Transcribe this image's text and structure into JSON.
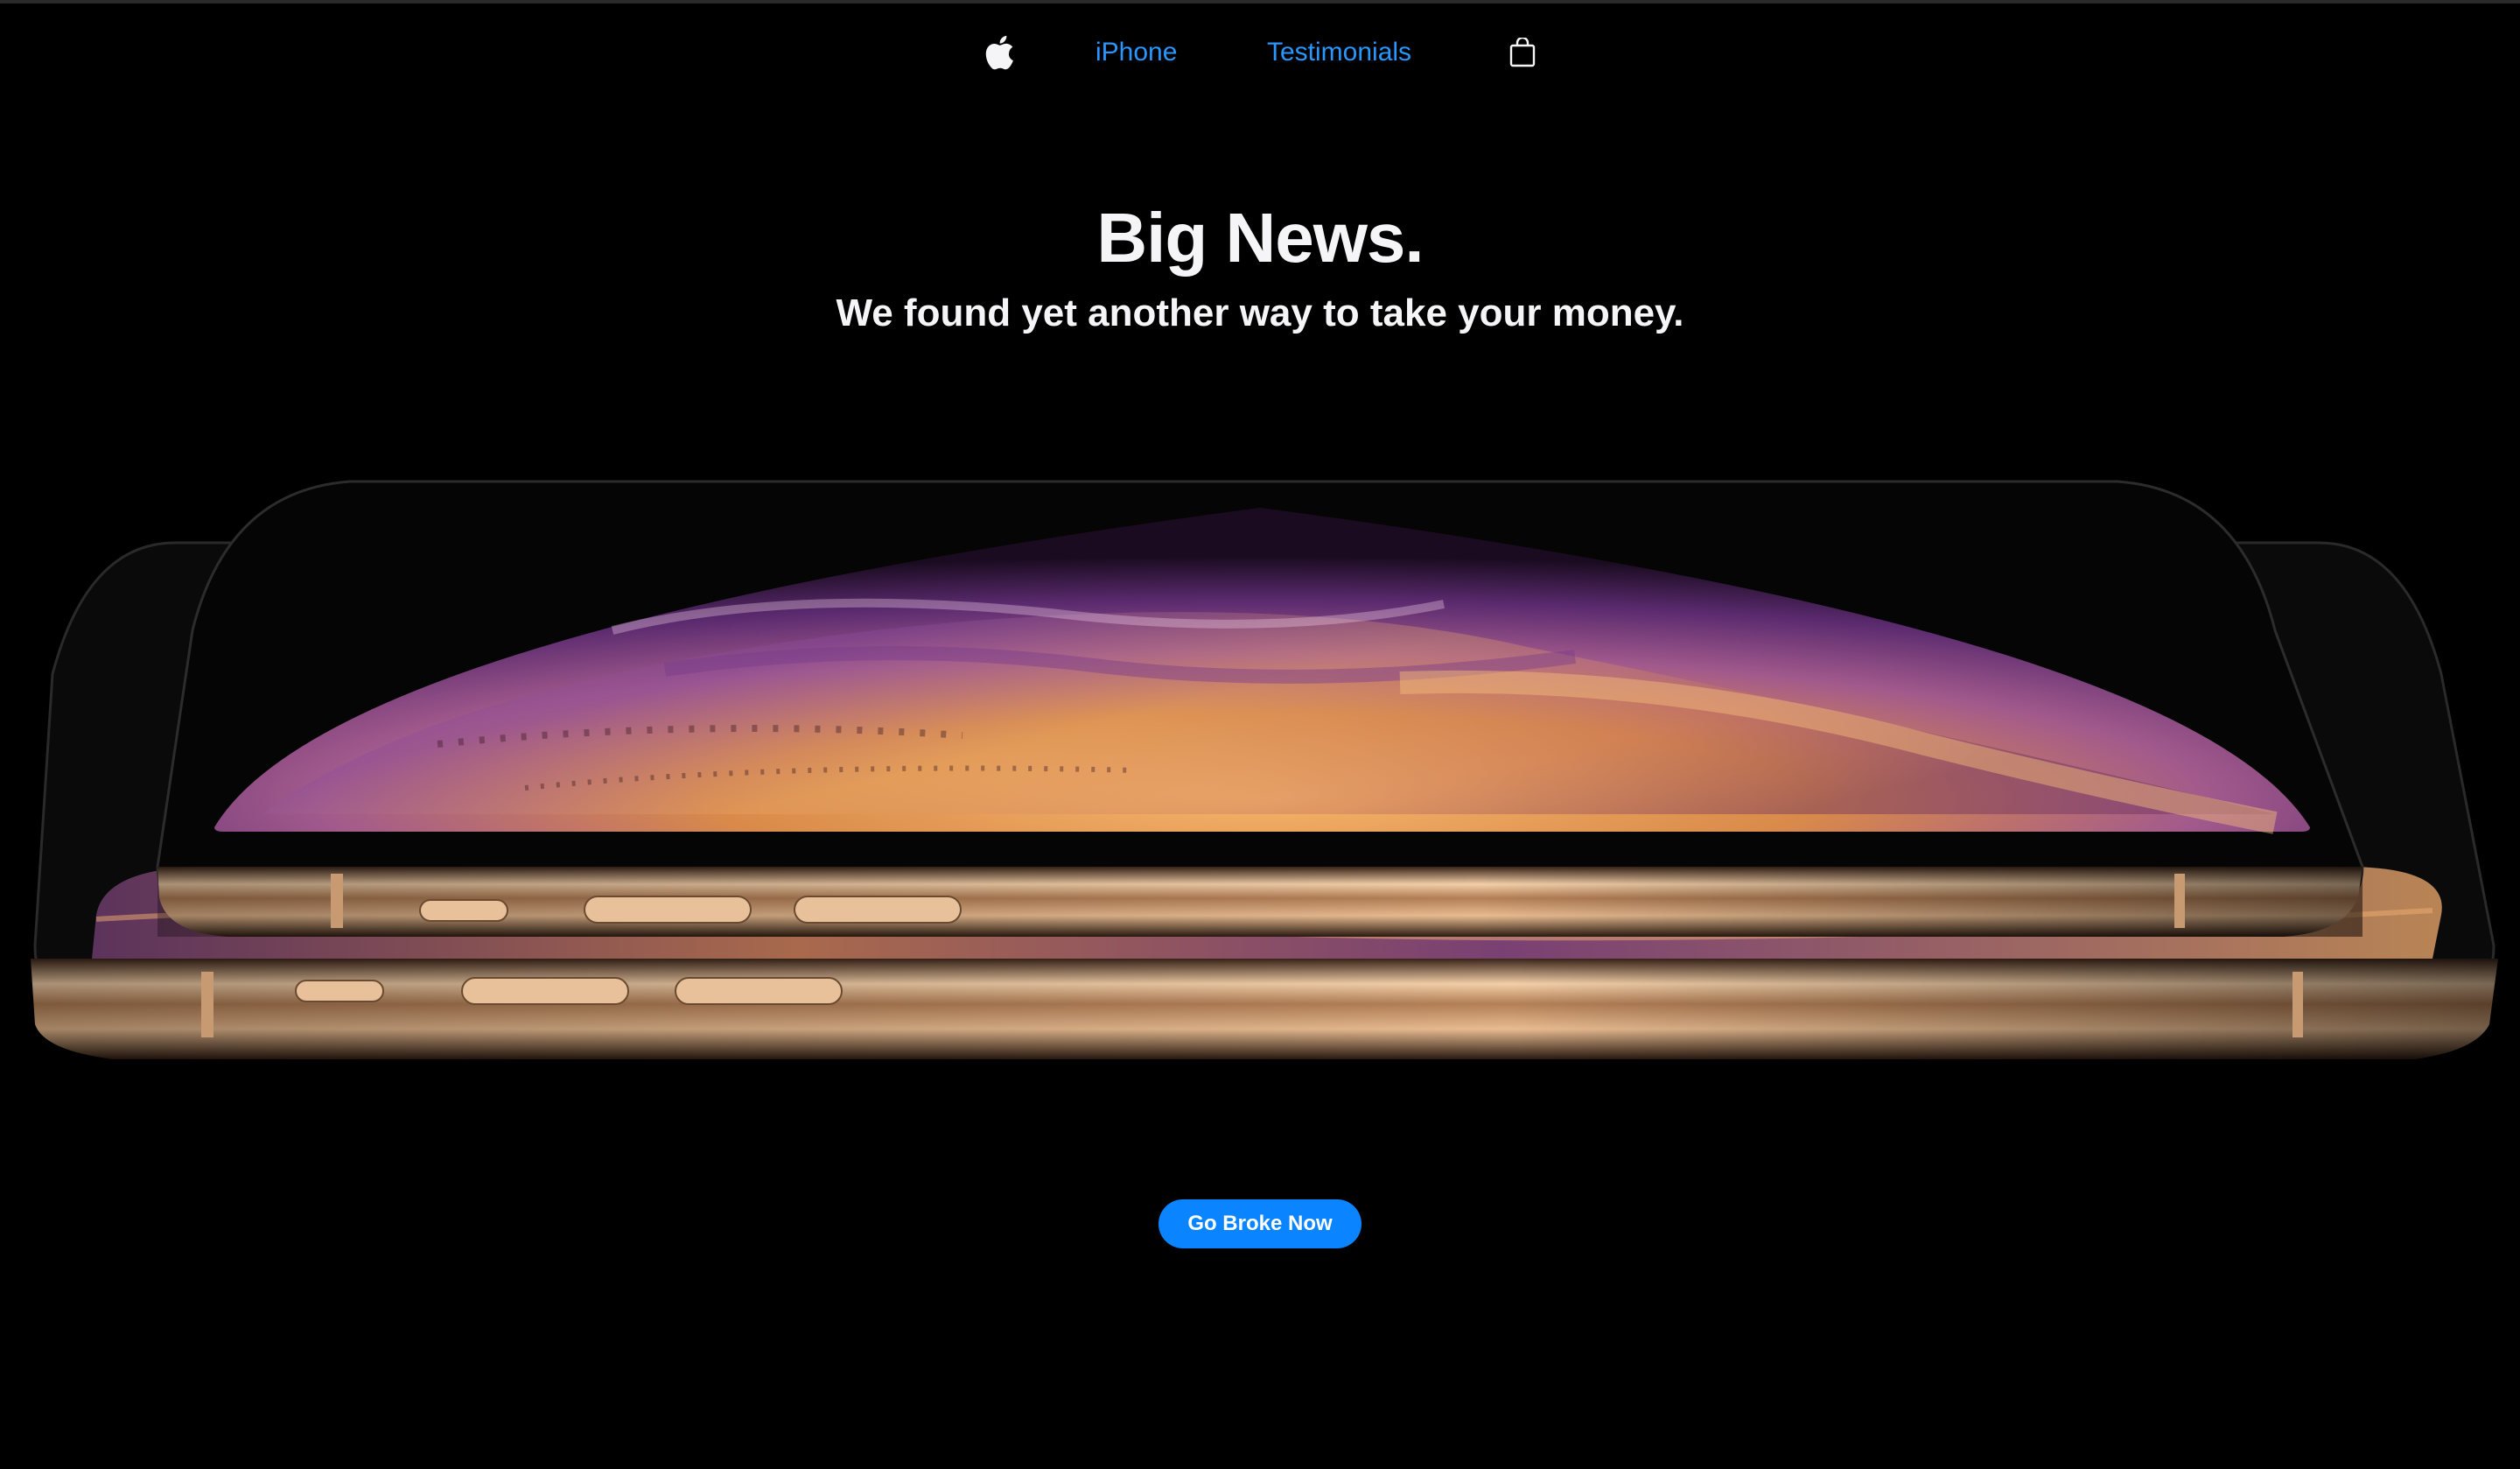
{
  "nav": {
    "logo_icon": "apple-logo-icon",
    "items": [
      {
        "label": "iPhone"
      },
      {
        "label": "Testimonials"
      }
    ],
    "bag_icon": "shopping-bag-icon",
    "link_color": "#2997ff"
  },
  "hero": {
    "headline": "Big News.",
    "subheadline": "We found yet another way to take your money.",
    "image": "iphone-xs-gold-pair-image",
    "cta_label": "Go Broke Now",
    "cta_color": "#0a84ff"
  },
  "colors": {
    "background": "#000000",
    "text": "#f5f5f7",
    "accent": "#0a84ff"
  }
}
